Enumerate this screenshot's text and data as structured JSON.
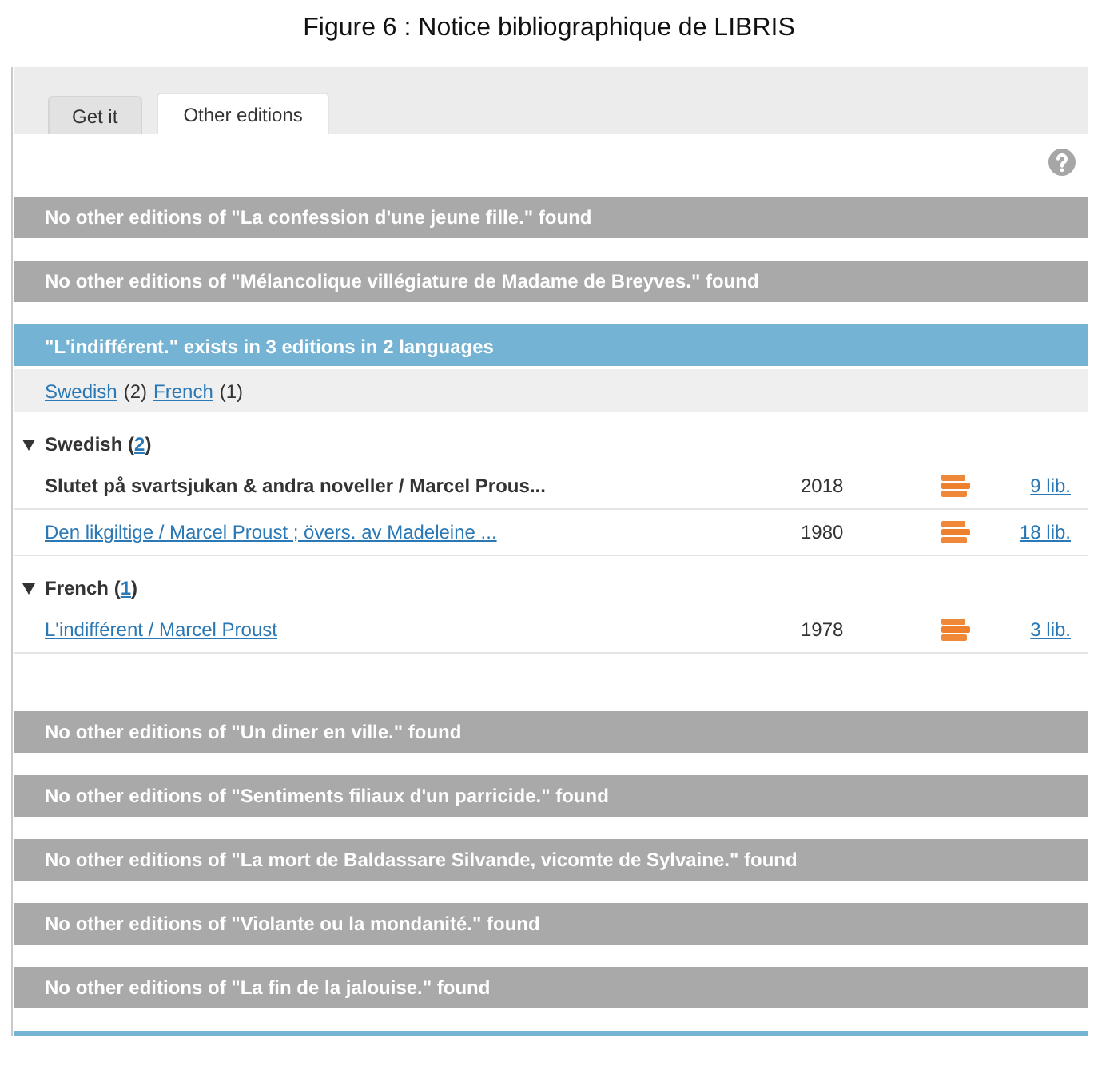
{
  "caption": "Figure 6 : Notice bibliographique de LIBRIS",
  "tabs": [
    {
      "label": "Get it",
      "selected": false
    },
    {
      "label": "Other editions",
      "selected": true
    }
  ],
  "sections": [
    {
      "kind": "none",
      "message": "No other editions of \"La confession d'une jeune fille.\" found"
    },
    {
      "kind": "none",
      "message": "No other editions of \"Mélancolique villégiature de Madame de Breyves.\" found"
    },
    {
      "kind": "found",
      "message": "\"L'indifférent.\" exists in 3 editions in 2 languages",
      "language_filter": [
        {
          "label": "Swedish",
          "count": "(2)"
        },
        {
          "label": "French",
          "count": "(1)"
        }
      ],
      "groups": [
        {
          "label": "Swedish",
          "count_open": "(",
          "count": "2",
          "count_close": ")",
          "expanded": true,
          "editions": [
            {
              "title": "Slutet på svartsjukan & andra noveller / Marcel Prous...",
              "linked": false,
              "year": "2018",
              "libraries": "9 lib."
            },
            {
              "title": "Den likgiltige / Marcel Proust ; övers. av Madeleine ...",
              "linked": true,
              "year": "1980",
              "libraries": "18 lib."
            }
          ]
        },
        {
          "label": "French",
          "count_open": "(",
          "count": "1",
          "count_close": ")",
          "expanded": true,
          "editions": [
            {
              "title": "L'indifférent / Marcel Proust",
              "linked": true,
              "year": "1978",
              "libraries": "3 lib."
            }
          ]
        }
      ]
    },
    {
      "kind": "none",
      "message": "No other editions of \"Un diner en ville.\" found"
    },
    {
      "kind": "none",
      "message": "No other editions of \"Sentiments filiaux d'un parricide.\" found"
    },
    {
      "kind": "none",
      "message": "No other editions of \"La mort de Baldassare Silvande, vicomte de Sylvaine.\" found"
    },
    {
      "kind": "none",
      "message": "No other editions of \"Violante ou la mondanité.\" found"
    },
    {
      "kind": "none",
      "message": "No other editions of \"La fin de la jalouise.\" found"
    },
    {
      "kind": "found"
    }
  ]
}
